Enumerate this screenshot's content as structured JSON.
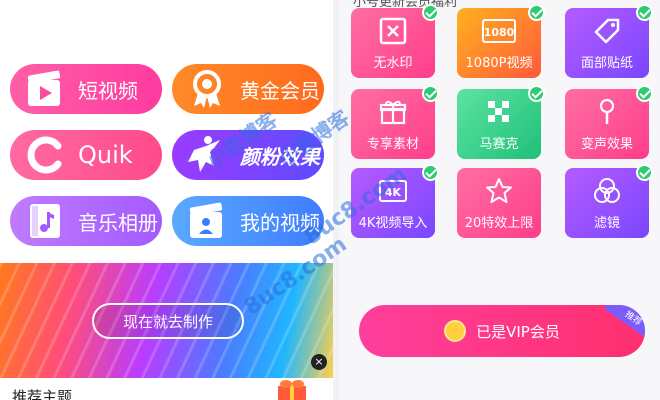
{
  "left": {
    "pills": {
      "short_video": "短视频",
      "gold_member": "黄金会员",
      "quik": "Quik",
      "effects": "颜粉效果",
      "music_album": "音乐相册",
      "my_video": "我的视频"
    },
    "banner": {
      "cta": "现在就去制作",
      "close": "×"
    },
    "section_title": "推荐主题"
  },
  "right": {
    "top_text": "小号更新会员福利",
    "tiles": [
      {
        "label": "无水印",
        "icon": "no-watermark-icon"
      },
      {
        "label": "1080P视频",
        "icon": "1080-icon"
      },
      {
        "label": "面部贴纸",
        "icon": "tag-icon"
      },
      {
        "label": "专享素材",
        "icon": "gift-icon"
      },
      {
        "label": "马赛克",
        "icon": "mosaic-icon"
      },
      {
        "label": "变声效果",
        "icon": "microphone-icon"
      },
      {
        "label": "4K视频导入",
        "icon": "4k-icon"
      },
      {
        "label": "20特效上限",
        "icon": "star-icon"
      },
      {
        "label": "滤镜",
        "icon": "filter-icon"
      }
    ],
    "vip": {
      "label": "已是VIP会员",
      "badge": "推荐"
    }
  },
  "watermark": {
    "line1": "小哲博客",
    "line2": "8uc8.com"
  },
  "colors": {
    "pink": "#ff3aa0",
    "orange": "#ff6a1e",
    "purple": "#8b45ff",
    "blue": "#3f7dff",
    "check_green": "#2ecc71"
  }
}
